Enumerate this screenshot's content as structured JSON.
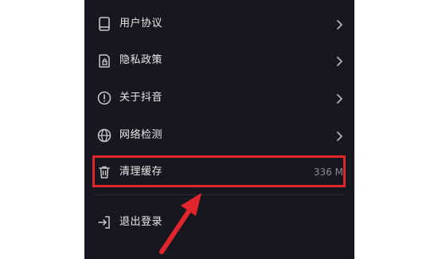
{
  "menu": {
    "items": [
      {
        "label": "用户协议",
        "icon": "document-icon",
        "has_chevron": true
      },
      {
        "label": "隐私政策",
        "icon": "lock-icon",
        "has_chevron": true
      },
      {
        "label": "关于抖音",
        "icon": "info-icon",
        "has_chevron": true
      },
      {
        "label": "网络检测",
        "icon": "globe-icon",
        "has_chevron": true
      },
      {
        "label": "清理缓存",
        "icon": "trash-icon",
        "value": "336 M",
        "has_chevron": false
      },
      {
        "label": "退出登录",
        "icon": "logout-icon",
        "has_chevron": false
      }
    ]
  },
  "annotation": {
    "highlight_color": "#e0262c",
    "highlighted_item": "清理缓存",
    "arrow_color": "#e0262c"
  },
  "colors": {
    "panel_background": "#17171f",
    "text_primary": "#e8e8ea",
    "text_secondary": "#8a8a93",
    "icon": "#c8c8cc",
    "chevron": "#b0b0b6"
  }
}
